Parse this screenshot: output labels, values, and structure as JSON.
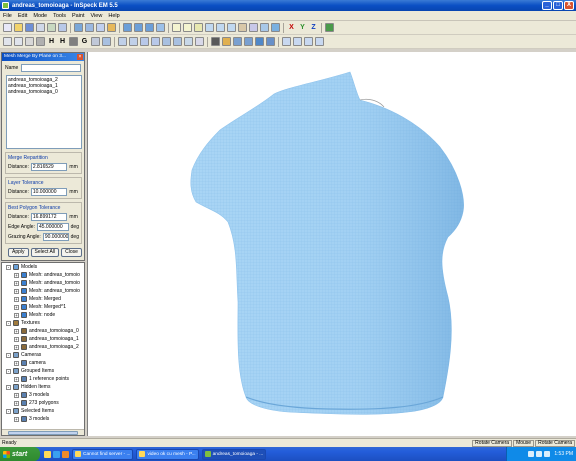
{
  "window": {
    "title": "andreas_tomoioaga - InSpeck EM 5.5",
    "controls": {
      "minimize": "_",
      "maximize": "□",
      "close": "X"
    }
  },
  "menu": [
    "File",
    "Edit",
    "Mode",
    "Tools",
    "Paint",
    "View",
    "Help"
  ],
  "toolbar_text_glyphs": {
    "h1": "H",
    "h2": "H",
    "g": "G",
    "x": "X",
    "y": "Y",
    "z": "Z"
  },
  "dialog": {
    "title": "Mesh Merge By Plane on 3...",
    "name_label": "Name",
    "name_value": "",
    "list_items": [
      "andreas_tomoioaga_2",
      "andreas_tomoioaga_1",
      "andreas_tomoioaga_0"
    ],
    "merge_repartition": {
      "title": "Merge Repartition",
      "distance_label": "Distance:",
      "distance_value": "2.816529",
      "distance_unit": "mm"
    },
    "layer_tolerance": {
      "title": "Layer Tolerance",
      "distance_label": "Distance:",
      "distance_value": "10.000000",
      "distance_unit": "mm"
    },
    "best_polygon": {
      "title": "Best Polygon Tolerance",
      "distance_label": "Distance:",
      "distance_value": "16.899172",
      "distance_unit": "mm",
      "edge_label": "Edge Angle:",
      "edge_value": "45.000000",
      "edge_unit": "deg",
      "grazing_label": "Grazing Angle:",
      "grazing_value": "90.000000",
      "grazing_unit": "deg"
    },
    "buttons": {
      "apply": "Apply",
      "select_all": "Select All",
      "close": "Close"
    }
  },
  "tree": [
    {
      "label": "Models",
      "level": 0,
      "expander": "-",
      "icon_color": "#6aa0d8"
    },
    {
      "label": "Mesh: andreas_tomoio",
      "level": 1,
      "expander": "+",
      "icon_color": "#3a7fd0"
    },
    {
      "label": "Mesh: andreas_tomoio",
      "level": 1,
      "expander": "+",
      "icon_color": "#3a7fd0"
    },
    {
      "label": "Mesh: andreas_tomoio",
      "level": 1,
      "expander": "+",
      "icon_color": "#3a7fd0"
    },
    {
      "label": "Mesh: Merged",
      "level": 1,
      "expander": "+",
      "icon_color": "#3a7fd0"
    },
    {
      "label": "Mesh: Merged^1",
      "level": 1,
      "expander": "+",
      "icon_color": "#3a7fd0"
    },
    {
      "label": "Mesh: node",
      "level": 1,
      "expander": "+",
      "icon_color": "#3a7fd0"
    },
    {
      "label": "Textures",
      "level": 0,
      "expander": "-",
      "icon_color": "#a07a3c"
    },
    {
      "label": "andreas_tomoioaga_0",
      "level": 1,
      "expander": "+",
      "icon_color": "#8a6a3a"
    },
    {
      "label": "andreas_tomoioaga_1",
      "level": 1,
      "expander": "+",
      "icon_color": "#8a6a3a"
    },
    {
      "label": "andreas_tomoioaga_2",
      "level": 1,
      "expander": "+",
      "icon_color": "#8a6a3a"
    },
    {
      "label": "Cameras",
      "level": 0,
      "expander": "-",
      "icon_color": "#7aa0c8"
    },
    {
      "label": "camera",
      "level": 1,
      "expander": "+",
      "icon_color": "#5a80b0"
    },
    {
      "label": "Grouped Items",
      "level": 0,
      "expander": "-",
      "icon_color": "#7aa0c8"
    },
    {
      "label": "1 reference points",
      "level": 1,
      "expander": "+",
      "icon_color": "#5a80b0"
    },
    {
      "label": "Hidden Items",
      "level": 0,
      "expander": "-",
      "icon_color": "#7aa0c8"
    },
    {
      "label": "3 models",
      "level": 1,
      "expander": "+",
      "icon_color": "#5a80b0"
    },
    {
      "label": "273 polygons",
      "level": 1,
      "expander": "+",
      "icon_color": "#5a80b0"
    },
    {
      "label": "Selected Items",
      "level": 0,
      "expander": "-",
      "icon_color": "#7aa0c8"
    },
    {
      "label": "3 models",
      "level": 1,
      "expander": "+",
      "icon_color": "#5a80b0"
    }
  ],
  "status": {
    "left": "Ready",
    "cells": [
      "Rotate Camera",
      "Mouse",
      "Rotate Camera"
    ]
  },
  "taskbar": {
    "start": "start",
    "tasks": [
      {
        "label": "Cannot find server - ...",
        "active": false
      },
      {
        "label": "video ok cu mesh - P...",
        "active": false
      },
      {
        "label": "andreas_tomoioaga - ...",
        "active": true
      }
    ],
    "clock": "1:53 PM"
  },
  "colors": {
    "mesh_fill": "#a9d5f5",
    "mesh_shade": "#7bb6e6",
    "title_blue": "#0a4fc4",
    "start_green": "#3c9a3c"
  }
}
